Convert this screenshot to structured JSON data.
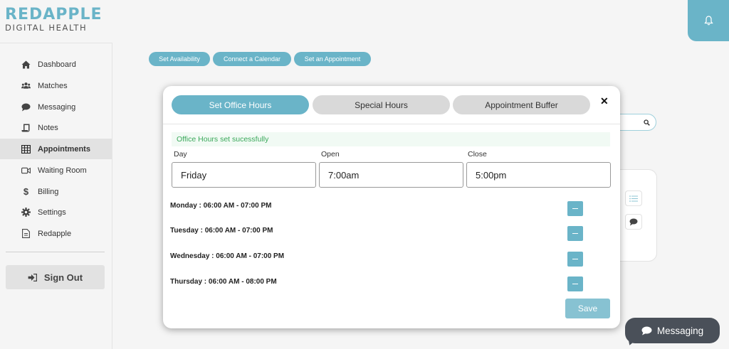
{
  "logo": {
    "top": "REDAPPLE",
    "bottom": "DIGITAL HEALTH"
  },
  "sidebar": {
    "items": [
      {
        "label": "Dashboard",
        "icon": "home-icon",
        "active": false
      },
      {
        "label": "Matches",
        "icon": "users-icon",
        "active": false
      },
      {
        "label": "Messaging",
        "icon": "chat-icon",
        "active": false
      },
      {
        "label": "Notes",
        "icon": "scroll-icon",
        "active": false
      },
      {
        "label": "Appointments",
        "icon": "table-icon",
        "active": true
      },
      {
        "label": "Waiting Room",
        "icon": "video-icon",
        "active": false
      },
      {
        "label": "Billing",
        "icon": "dollar-icon",
        "active": false
      },
      {
        "label": "Settings",
        "icon": "gear-icon",
        "active": false
      },
      {
        "label": "Redapple",
        "icon": "document-icon",
        "active": false
      }
    ],
    "signout_label": "Sign Out"
  },
  "actions": {
    "set_availability": "Set Availability",
    "connect_calendar": "Connect a Calendar",
    "set_appointment": "Set an Appointment"
  },
  "modal": {
    "tabs": [
      "Set Office Hours",
      "Special Hours",
      "Appointment Buffer"
    ],
    "active_tab": 0,
    "close": "✕",
    "success_message": "Office Hours set sucessfully",
    "labels": {
      "day": "Day",
      "open": "Open",
      "close": "Close"
    },
    "values": {
      "day": "Friday",
      "open": "7:00am",
      "close": "5:00pm"
    },
    "hours": [
      "Monday : 06:00 AM - 07:00 PM",
      "Tuesday : 06:00 AM - 07:00 PM",
      "Wednesday : 06:00 AM - 07:00 PM",
      "Thursday : 06:00 AM - 08:00 PM"
    ],
    "save_label": "Save"
  },
  "messaging_bubble": {
    "label": "Messaging"
  },
  "colors": {
    "accent": "#6ab4c8",
    "success": "#3aa85a",
    "bubble": "#4a5059"
  }
}
